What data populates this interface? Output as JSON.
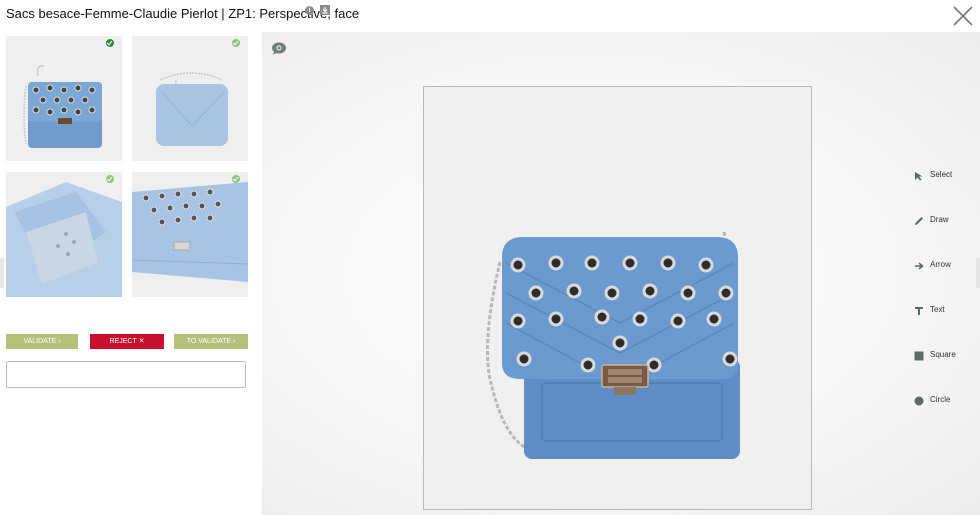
{
  "header": {
    "title": "Sacs besace-Femme-Claudie Pierlot | ZP1: Perspective, face",
    "info_glyph": "i",
    "icons": [
      "info-icon",
      "download-icon",
      "close-icon"
    ]
  },
  "thumbnails": [
    {
      "name": "thumb-front",
      "status": "validated"
    },
    {
      "name": "thumb-side",
      "status": "validated"
    },
    {
      "name": "thumb-interior",
      "status": "validated"
    },
    {
      "name": "thumb-detail",
      "status": "validated"
    }
  ],
  "actions": {
    "validate_label": "VALIDATE ›",
    "reject_label": "REJECT ✕",
    "to_validate_label": "TO VALIDATE ›"
  },
  "comment": {
    "value": "",
    "placeholder": ""
  },
  "tools": [
    {
      "label": "Select",
      "icon": "cursor-icon"
    },
    {
      "label": "Draw",
      "icon": "pencil-icon"
    },
    {
      "label": "Arrow",
      "icon": "arrow-icon"
    },
    {
      "label": "Text",
      "icon": "text-icon"
    },
    {
      "label": "Square",
      "icon": "square-icon"
    },
    {
      "label": "Circle",
      "icon": "circle-icon"
    }
  ],
  "colors": {
    "validate": "#b5c07a",
    "reject": "#c8102e",
    "check_dark": "#2e8b3a",
    "check_light": "#8fc57e",
    "denim": "#6f9ccd",
    "tool_icon": "#5b6b66"
  }
}
